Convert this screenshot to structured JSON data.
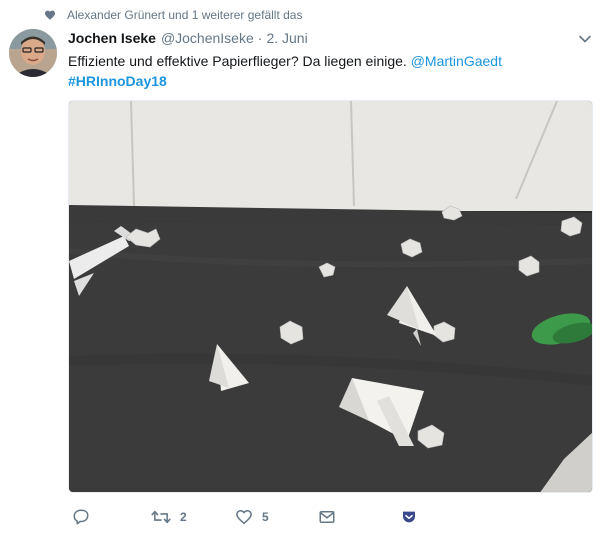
{
  "social_context": {
    "text": "Alexander Grünert und 1 weiterer gefällt das",
    "icon": "heart-icon"
  },
  "tweet": {
    "fullname": "Jochen Iseke",
    "handle": "@JochenIseke",
    "separator": "·",
    "time": "2. Juni",
    "text_plain": "Effiziente und effektive Papierflieger? Da liegen einige.",
    "mention": "@MartinGaedt",
    "hashtag": "#HRInnoDay18"
  },
  "actions": {
    "reply": {
      "icon": "reply-icon",
      "count": ""
    },
    "retweet": {
      "icon": "retweet-icon",
      "count": "2"
    },
    "like": {
      "icon": "heart-outline-icon",
      "count": "5"
    },
    "dm": {
      "icon": "envelope-icon",
      "count": ""
    },
    "pocket": {
      "icon": "pocket-icon",
      "count": ""
    }
  },
  "colors": {
    "link": "#1b95e0",
    "secondary": "#657786",
    "text": "#14171a",
    "pocket": "#3b4a8a"
  }
}
